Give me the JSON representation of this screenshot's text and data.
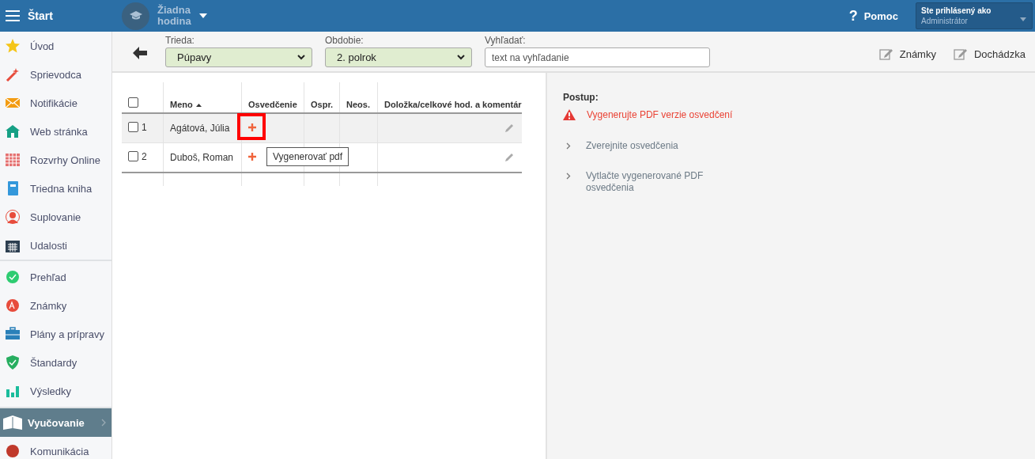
{
  "topbar": {
    "menu_label": "Štart",
    "lesson": "Žiadna\nhodina",
    "help_icon": "?",
    "help": "Pomoc",
    "user_caption": "Ste prihlásený ako",
    "user_role": "Administrátor"
  },
  "sidebar": {
    "groups": [
      [
        {
          "label": "Úvod",
          "selected": false
        },
        {
          "label": "Sprievodca",
          "selected": false
        },
        {
          "label": "Notifikácie",
          "selected": false
        },
        {
          "label": "Web stránka",
          "selected": false
        },
        {
          "label": "Rozvrhy Online",
          "selected": false
        },
        {
          "label": "Triedna kniha",
          "selected": false
        },
        {
          "label": "Suplovanie",
          "selected": false
        },
        {
          "label": "Udalosti",
          "selected": false
        }
      ],
      [
        {
          "label": "Prehľad",
          "selected": false
        },
        {
          "label": "Známky",
          "selected": false
        },
        {
          "label": "Plány a prípravy",
          "selected": false
        },
        {
          "label": "Štandardy",
          "selected": false
        },
        {
          "label": "Výsledky",
          "selected": false
        }
      ],
      [
        {
          "label": "Vyučovanie",
          "selected": true
        },
        {
          "label": "Komunikácia",
          "selected": false
        }
      ]
    ]
  },
  "toolbar": {
    "class_label": "Trieda:",
    "class_value": "Púpavy",
    "period_label": "Obdobie:",
    "period_value": "2. polrok",
    "search_label": "Vyhľadať:",
    "search_placeholder": "text na vyhľadanie",
    "links": [
      "Známky",
      "Dochádzka"
    ]
  },
  "table": {
    "columns": [
      "Meno",
      "Osvedčenie",
      "Ospr.",
      "Neos.",
      "Doložka/celkové hod. a komentár"
    ],
    "all_checked": false,
    "rows": [
      {
        "number": "1",
        "name": "Agátová, Júlia",
        "checked": false,
        "hovered": true
      },
      {
        "number": "2",
        "name": "Duboš, Roman",
        "checked": false,
        "hovered": false
      }
    ]
  },
  "tooltip": "Vygenerovať pdf",
  "steps": {
    "title": "Postup:",
    "items": [
      {
        "kind": "warning",
        "text": "Vygenerujte PDF verzie osvedčení"
      },
      {
        "kind": "pending",
        "text": "Zverejnite osvedčenia"
      },
      {
        "kind": "pending",
        "text": "Vytlačte vygenerované PDF\nosvedčenia"
      }
    ]
  }
}
